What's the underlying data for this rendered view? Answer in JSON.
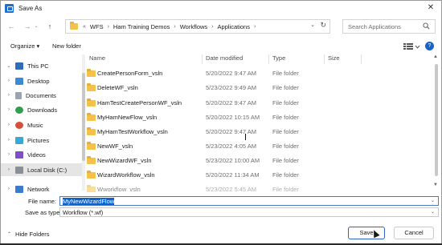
{
  "window": {
    "title": "Save As",
    "close_glyph": "✕"
  },
  "nav": {
    "back": "←",
    "forward": "→",
    "recent": "⌄",
    "up": "↑",
    "breadcrumb_overflow": "«",
    "breadcrumbs": [
      "WFS",
      "Ham Training Demos",
      "Workflows",
      "Applications"
    ],
    "separator": "›",
    "dropdown": "⌄",
    "refresh": "↻"
  },
  "search": {
    "placeholder": "Search Applications"
  },
  "toolbar": {
    "organize": "Organize ▾",
    "new_folder": "New folder",
    "help": "?"
  },
  "sidebar": {
    "items": [
      {
        "label": "This PC",
        "icon": "computer-icon",
        "chevron": "⌄"
      },
      {
        "label": "Desktop",
        "icon": "desktop-icon",
        "chevron": "›"
      },
      {
        "label": "Documents",
        "icon": "documents-icon",
        "chevron": "›"
      },
      {
        "label": "Downloads",
        "icon": "downloads-icon",
        "chevron": "›"
      },
      {
        "label": "Music",
        "icon": "music-icon",
        "chevron": "›"
      },
      {
        "label": "Pictures",
        "icon": "pictures-icon",
        "chevron": "›"
      },
      {
        "label": "Videos",
        "icon": "videos-icon",
        "chevron": "›"
      },
      {
        "label": "Local Disk (C:)",
        "icon": "drive-icon",
        "chevron": "›"
      },
      {
        "label": "Network",
        "icon": "network-icon",
        "chevron": "›"
      }
    ]
  },
  "file_list": {
    "columns": [
      "Name",
      "Date modified",
      "Type",
      "Size"
    ],
    "sort_caret": "^",
    "rows": [
      {
        "name": "CreatePersonForm_vsln",
        "date": "5/20/2022 9:47 AM",
        "type": "File folder"
      },
      {
        "name": "DeleteWF_vsln",
        "date": "5/23/2022 9:49 AM",
        "type": "File folder"
      },
      {
        "name": "HamTestCreatePersonWF_vsln",
        "date": "5/20/2022 9:47 AM",
        "type": "File folder"
      },
      {
        "name": "MyHamNewFlow_vsln",
        "date": "5/20/2022 10:15 AM",
        "type": "File folder"
      },
      {
        "name": "MyHamTestWorkflow_vsln",
        "date": "5/20/2022 9:47 AM",
        "type": "File folder"
      },
      {
        "name": "NewWF_vsln",
        "date": "5/23/2022 4:05 AM",
        "type": "File folder"
      },
      {
        "name": "NewWizardWF_vsln",
        "date": "5/23/2022 10:00 AM",
        "type": "File folder"
      },
      {
        "name": "WizardWorkflow_vsln",
        "date": "5/20/2022 11:34 AM",
        "type": "File folder"
      },
      {
        "name": "Wworkflow_vsln",
        "date": "5/23/2022 5:45 AM",
        "type": "File folder"
      }
    ],
    "scroll_up": "▲",
    "scroll_down": "▼"
  },
  "form": {
    "file_name_label": "File name:",
    "file_name_value": "MyNewWizardFlow",
    "save_as_type_label": "Save as type:",
    "save_as_type_value": "Workflow (*.wf)",
    "chevron": "⌄"
  },
  "footer": {
    "hide_folders": "Hide Folders",
    "hide_chevron": "⌃",
    "save": "Save",
    "cancel": "Cancel"
  },
  "colors": {
    "accent": "#0b63ce",
    "folder": "#f3c24a",
    "selection": "#e5e5e5"
  }
}
